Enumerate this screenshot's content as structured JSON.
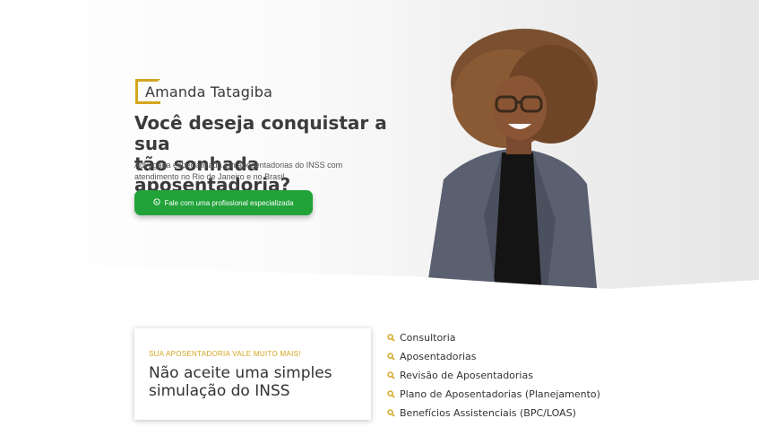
{
  "brand": {
    "name": "Amanda Tatagiba",
    "accent_color": "#d4a520"
  },
  "hero": {
    "headline_line1": "Você deseja conquistar a sua",
    "headline_line2": "tão sonhada aposentadoria?",
    "subtitle_line1": "Advogada especializada em aposentadorias do INSS com",
    "subtitle_line2": "atendimento no Rio de Janeiro e no Brasil.",
    "cta_label": "Fale com uma profissional especializada",
    "cta_color": "#22a33a",
    "cta_icon": "whatsapp-icon"
  },
  "card": {
    "eyebrow": "SUA APOSENTADORIA VALE MUITO MAIS!",
    "title_line1": "Não aceite uma simples",
    "title_line2": "simulação do INSS"
  },
  "services": {
    "icon": "search-icon",
    "items": [
      "Consultoria",
      "Aposentadorias",
      "Revisão de Aposentadorias",
      "Plano de Aposentadorias (Planejamento)",
      "Benefícios Assistenciais (BPC/LOAS)"
    ]
  }
}
